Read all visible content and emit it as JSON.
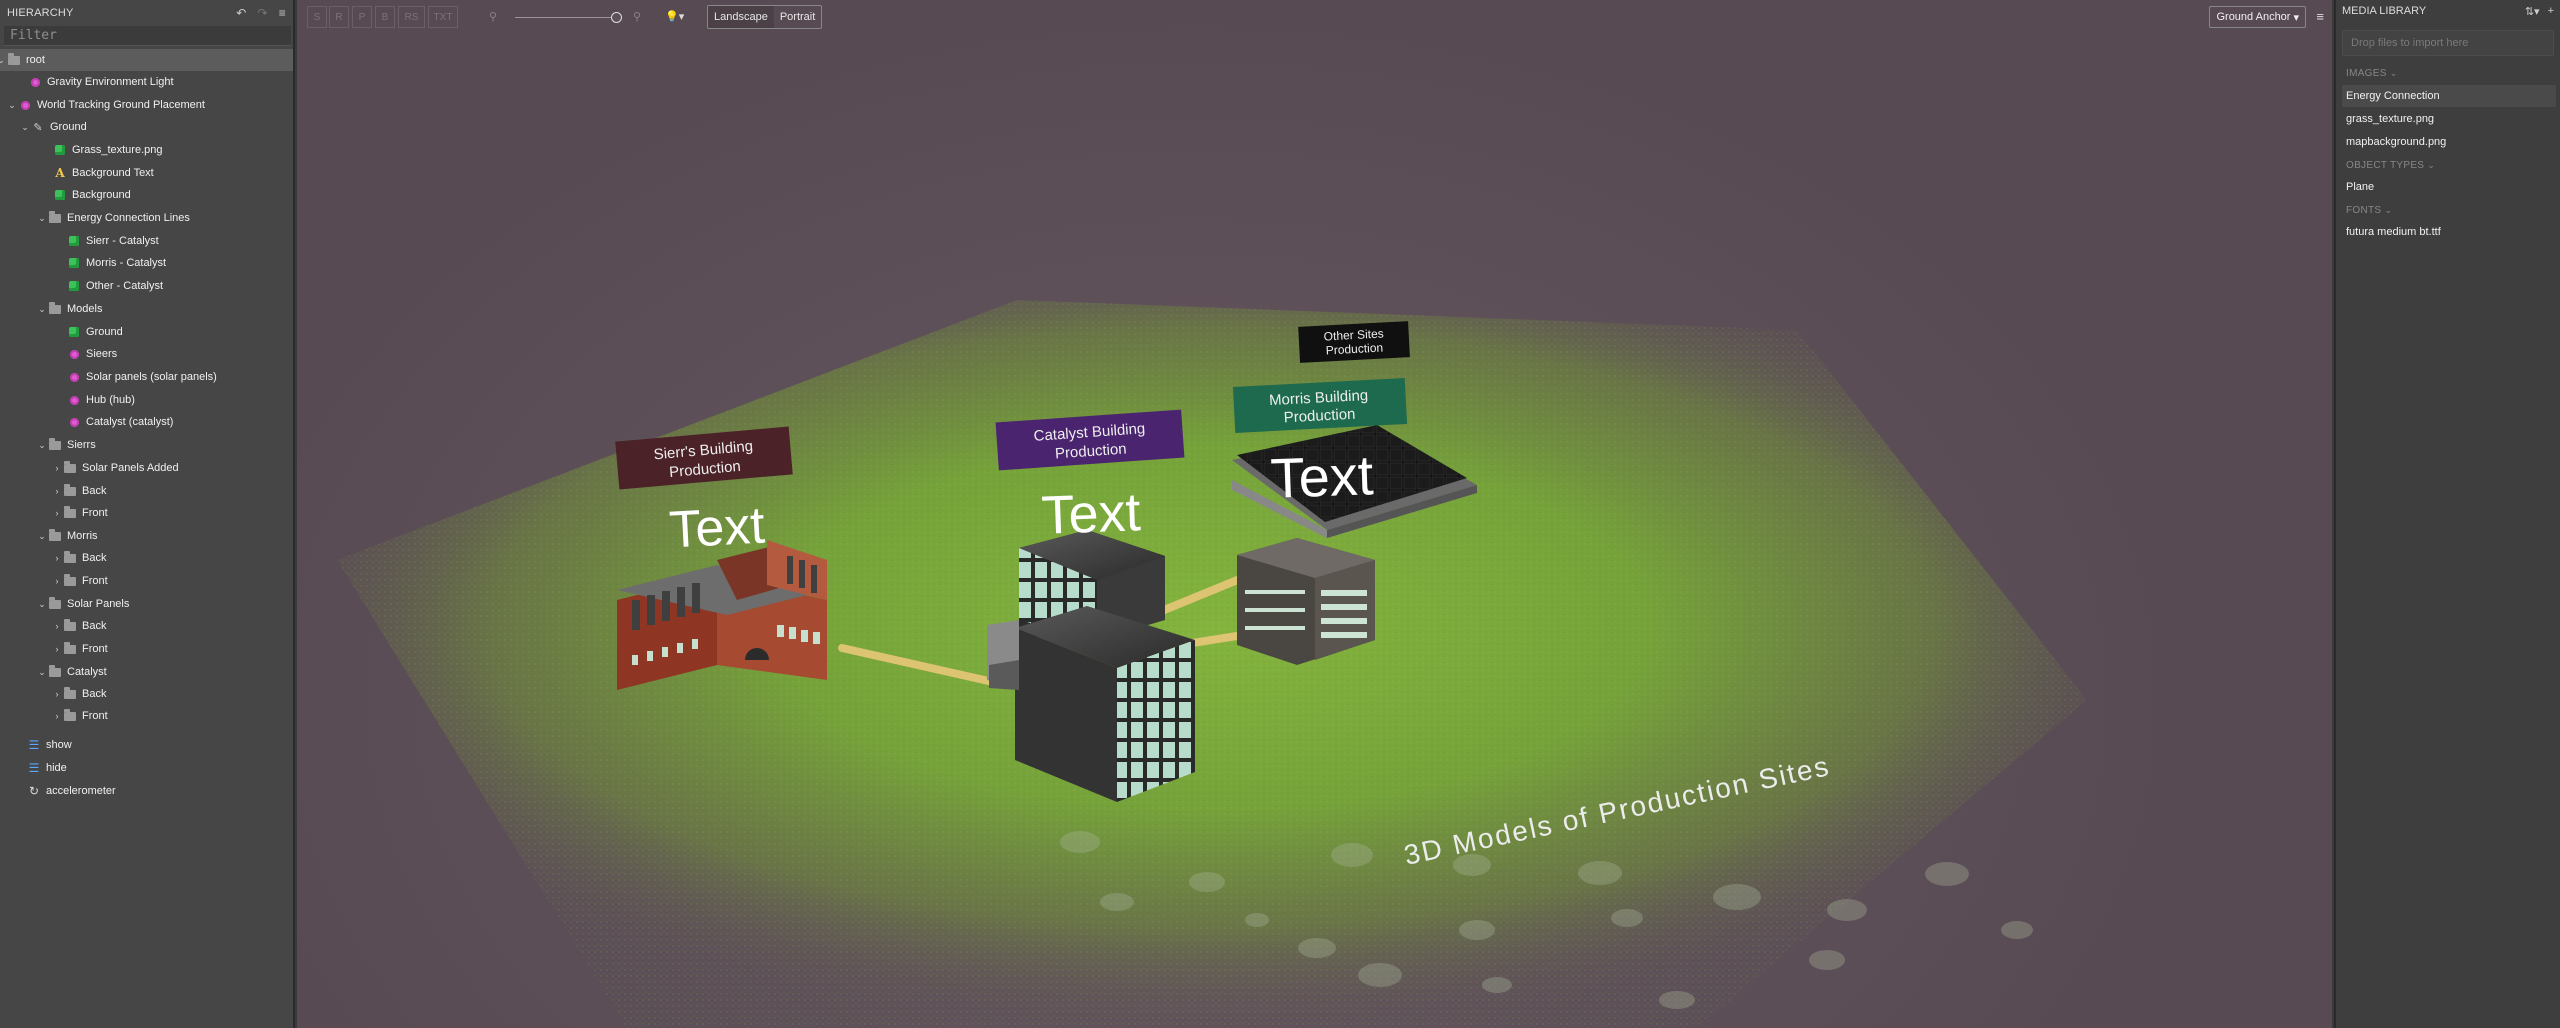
{
  "hierarchy": {
    "title": "HIERARCHY",
    "filter_placeholder": "Filter",
    "rows": [
      {
        "label": "root",
        "icon": "folder",
        "chev": "down",
        "selected": true,
        "bold": true
      },
      {
        "label": "Gravity Environment Light",
        "icon": "dot-pink"
      },
      {
        "label": "World Tracking Ground Placement",
        "icon": "dot-pink",
        "chev": "down"
      },
      {
        "label": "Ground",
        "icon": "tag",
        "chev": "down"
      },
      {
        "label": "Grass_texture.png",
        "icon": "cube-green"
      },
      {
        "label": "Background Text",
        "icon": "text-a"
      },
      {
        "label": "Background",
        "icon": "cube-green"
      },
      {
        "label": "Energy Connection Lines",
        "icon": "folder",
        "chev": "down"
      },
      {
        "label": "Sierr - Catalyst",
        "icon": "cube-green"
      },
      {
        "label": "Morris - Catalyst",
        "icon": "cube-green"
      },
      {
        "label": "Other - Catalyst",
        "icon": "cube-green"
      },
      {
        "label": "Models",
        "icon": "folder",
        "chev": "down"
      },
      {
        "label": "Ground",
        "icon": "cube-green"
      },
      {
        "label": "Sieers",
        "icon": "dot-pink"
      },
      {
        "label": "Solar panels (solar panels)",
        "icon": "dot-pink"
      },
      {
        "label": "Hub (hub)",
        "icon": "dot-pink"
      },
      {
        "label": "Catalyst (catalyst)",
        "icon": "dot-pink"
      },
      {
        "label": "Sierrs",
        "icon": "folder",
        "chev": "down"
      },
      {
        "label": "Solar Panels Added",
        "icon": "folder",
        "chev": "right"
      },
      {
        "label": "Back",
        "icon": "folder",
        "chev": "right"
      },
      {
        "label": "Front",
        "icon": "folder",
        "chev": "right"
      },
      {
        "label": "Morris",
        "icon": "folder",
        "chev": "down"
      },
      {
        "label": "Back",
        "icon": "folder",
        "chev": "right"
      },
      {
        "label": "Front",
        "icon": "folder",
        "chev": "right"
      },
      {
        "label": "Solar Panels",
        "icon": "folder",
        "chev": "down"
      },
      {
        "label": "Back",
        "icon": "folder",
        "chev": "right"
      },
      {
        "label": "Front",
        "icon": "folder",
        "chev": "right"
      },
      {
        "label": "Catalyst",
        "icon": "folder",
        "chev": "down"
      },
      {
        "label": "Back",
        "icon": "folder",
        "chev": "right"
      },
      {
        "label": "Front",
        "icon": "folder",
        "chev": "right"
      },
      {
        "label": "show",
        "icon": "list"
      },
      {
        "label": "hide",
        "icon": "list"
      },
      {
        "label": "accelerometer",
        "icon": "cycle"
      }
    ]
  },
  "toolbar": {
    "tools": [
      "S",
      "R",
      "P",
      "B",
      "RS",
      "TXT"
    ],
    "orientation": [
      "Landscape",
      "Portrait"
    ],
    "active_orientation": "Landscape",
    "anchor_label": "Ground Anchor"
  },
  "scene": {
    "labels": {
      "sierr": "Sierr's Building Production",
      "catalyst": "Catalyst Building Production",
      "morris": "Morris Building Production",
      "other": "Other Sites Production"
    },
    "placeholder_text": "Text",
    "ground_text": "3D Models of Production Sites",
    "colors": {
      "sierr": "#4a2228",
      "catalyst": "#4b2470",
      "morris": "#1d6a4e",
      "other": "#101010",
      "grass": "#7aa63c",
      "line": "#e2c676"
    }
  },
  "media_library": {
    "title": "MEDIA LIBRARY",
    "drop_placeholder": "Drop files to import here",
    "sections": {
      "images": "IMAGES",
      "object_types": "OBJECT TYPES",
      "fonts": "FONTS"
    },
    "images": [
      "Energy Connection",
      "grass_texture.png",
      "mapbackground.png"
    ],
    "object_types": [
      "Plane"
    ],
    "fonts": [
      "futura medium bt.ttf"
    ]
  }
}
